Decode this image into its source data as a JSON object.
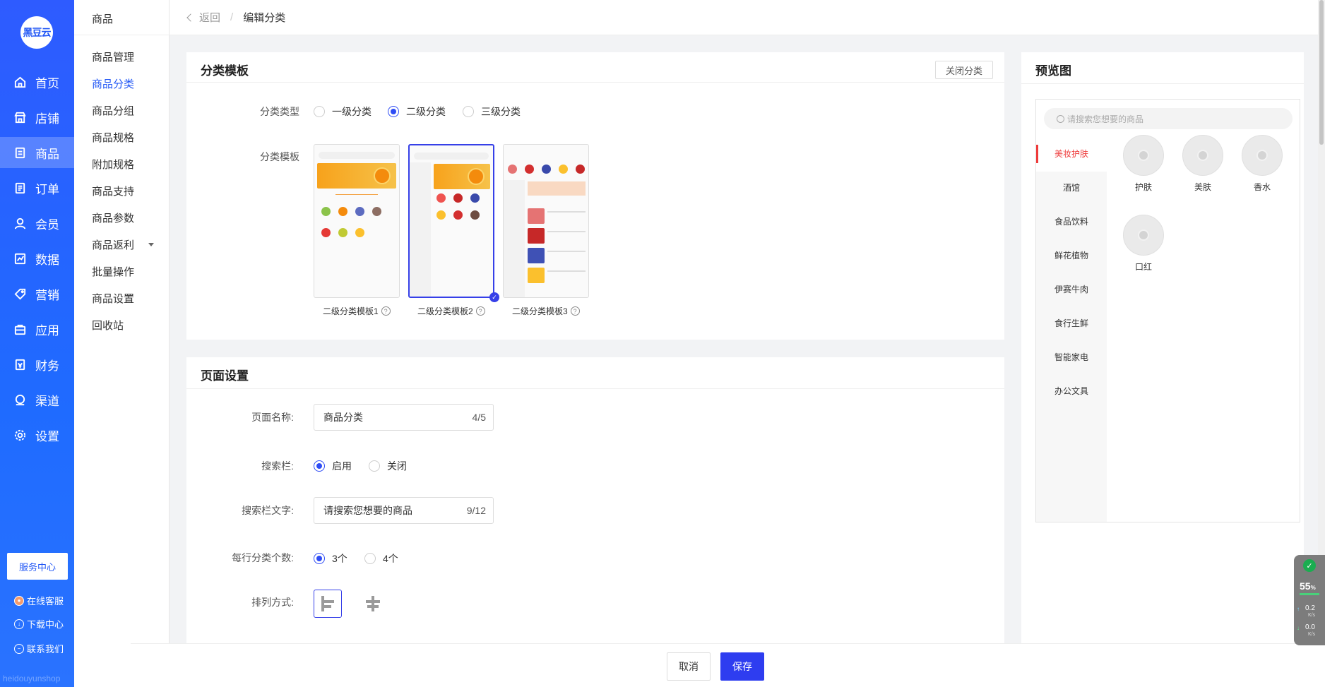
{
  "sidebar": {
    "logo": "黑豆云",
    "items": [
      {
        "label": "首页"
      },
      {
        "label": "店铺"
      },
      {
        "label": "商品"
      },
      {
        "label": "订单"
      },
      {
        "label": "会员"
      },
      {
        "label": "数据"
      },
      {
        "label": "营销"
      },
      {
        "label": "应用"
      },
      {
        "label": "财务"
      },
      {
        "label": "渠道"
      },
      {
        "label": "设置"
      }
    ],
    "service_center": "服务中心",
    "links": [
      {
        "label": "在线客服"
      },
      {
        "label": "下载中心"
      },
      {
        "label": "联系我们"
      }
    ],
    "watermark": "heidouyunshop"
  },
  "subnav": {
    "title": "商品",
    "items": [
      {
        "label": "商品管理"
      },
      {
        "label": "商品分类"
      },
      {
        "label": "商品分组"
      },
      {
        "label": "商品规格"
      },
      {
        "label": "附加规格"
      },
      {
        "label": "商品支持"
      },
      {
        "label": "商品参数"
      },
      {
        "label": "商品返利"
      },
      {
        "label": "批量操作"
      },
      {
        "label": "商品设置"
      },
      {
        "label": "回收站"
      }
    ]
  },
  "topbar": {
    "back": "返回",
    "sep": "/",
    "current": "编辑分类"
  },
  "template_card": {
    "title": "分类模板",
    "close_btn": "关闭分类",
    "type_label": "分类类型",
    "types": [
      {
        "label": "一级分类"
      },
      {
        "label": "二级分类"
      },
      {
        "label": "三级分类"
      }
    ],
    "template_label": "分类模板",
    "templates": [
      {
        "label": "二级分类模板1"
      },
      {
        "label": "二级分类模板2"
      },
      {
        "label": "二级分类模板3"
      }
    ],
    "selected_template": "二级分类模板2"
  },
  "page_card": {
    "title": "页面设置",
    "page_name_label": "页面名称:",
    "page_name_value": "商品分类",
    "page_name_count": "4/5",
    "search_bar_label": "搜索栏:",
    "search_bar_options": [
      {
        "label": "启用"
      },
      {
        "label": "关闭"
      }
    ],
    "search_text_label": "搜索栏文字:",
    "search_text_value": "请搜索您想要的商品",
    "search_text_count": "9/12",
    "per_row_label": "每行分类个数:",
    "per_row_options": [
      {
        "label": "3个"
      },
      {
        "label": "4个"
      }
    ],
    "arrange_label": "排列方式:"
  },
  "preview": {
    "title": "预览图",
    "search_placeholder": "请搜索您想要的商品",
    "categories": [
      {
        "label": "美妆护肤"
      },
      {
        "label": "酒馆"
      },
      {
        "label": "食品饮料"
      },
      {
        "label": "鲜花植物"
      },
      {
        "label": "伊赛牛肉"
      },
      {
        "label": "食行生鲜"
      },
      {
        "label": "智能家电"
      },
      {
        "label": "办公文具"
      }
    ],
    "subcategories": [
      {
        "label": "护肤"
      },
      {
        "label": "美肤"
      },
      {
        "label": "香水"
      },
      {
        "label": "口红"
      }
    ]
  },
  "footer": {
    "cancel": "取消",
    "save": "保存"
  },
  "widget": {
    "percent": "55",
    "percent_unit": "%",
    "up": "0.2",
    "down": "0.0",
    "unit": "K/s"
  },
  "colors": {
    "primary": "#2e4cf5",
    "nav": "#2257f5",
    "active_category": "#ee3b3b"
  }
}
